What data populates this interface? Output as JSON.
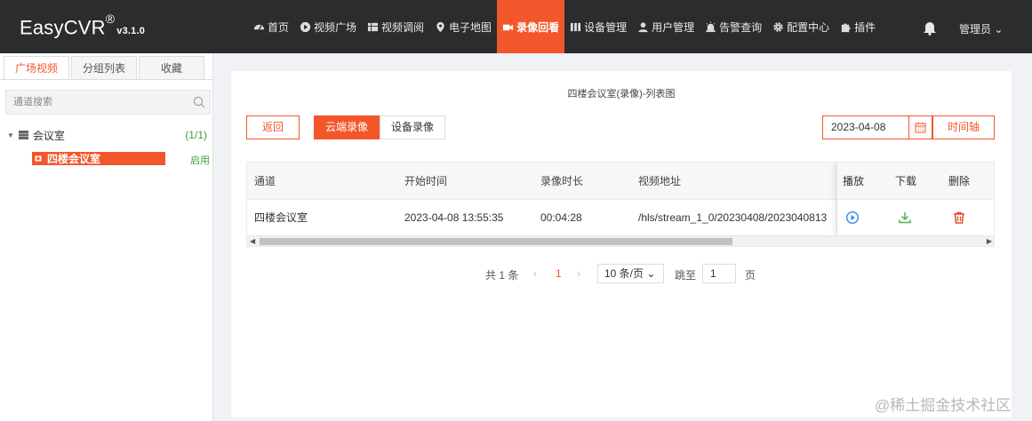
{
  "app": {
    "logo": "EasyCVR",
    "logo_reg": "®",
    "version": "v3.1.0"
  },
  "nav": [
    {
      "label": "首页",
      "icon": "dashboard-icon"
    },
    {
      "label": "视频广场",
      "icon": "play-circle-icon"
    },
    {
      "label": "视频调阅",
      "icon": "grid-icon"
    },
    {
      "label": "电子地图",
      "icon": "map-pin-icon"
    },
    {
      "label": "录像回看",
      "icon": "video-camera-icon",
      "active": true
    },
    {
      "label": "设备管理",
      "icon": "device-icon"
    },
    {
      "label": "用户管理",
      "icon": "user-icon"
    },
    {
      "label": "告警查询",
      "icon": "alarm-icon"
    },
    {
      "label": "配置中心",
      "icon": "gear-icon"
    },
    {
      "label": "插件",
      "icon": "puzzle-icon"
    }
  ],
  "header_user": "管理员 ⌄",
  "sidebar": {
    "tabs": [
      "广场视频",
      "分组列表",
      "收藏"
    ],
    "active_tab": 0,
    "search_placeholder": "通道搜索",
    "tree": {
      "root_label": "会议室",
      "root_count": "(1/1)",
      "child_label": "四楼会议室",
      "child_status": "启用"
    }
  },
  "main": {
    "title": "四楼会议室(录像)-列表图",
    "back_label": "返回",
    "source_tabs": [
      "云端录像",
      "设备录像"
    ],
    "active_source": 0,
    "date_value": "2023-04-08",
    "timeline_label": "时间轴",
    "table": {
      "headers": [
        "通道",
        "开始时间",
        "录像时长",
        "视频地址",
        "播放",
        "下载",
        "删除"
      ],
      "rows": [
        {
          "channel": "四楼会议室",
          "start_time": "2023-04-08 13:55:35",
          "duration": "00:04:28",
          "url": "/hls/stream_1_0/20230408/2023040813"
        }
      ]
    },
    "pager": {
      "total": "共 1 条",
      "prev": "‹",
      "current": "1",
      "next": "›",
      "page_size": "10 条/页 ⌄",
      "goto_label": "跳至",
      "goto_value": "1",
      "page_suffix": "页"
    }
  },
  "watermark": "@稀土掘金技术社区",
  "colors": {
    "accent": "#f2572b",
    "topbar": "#2a2c2e",
    "success": "#3aa13a",
    "play": "#2d8cf0",
    "download": "#52b24c",
    "delete": "#e64a2e"
  }
}
